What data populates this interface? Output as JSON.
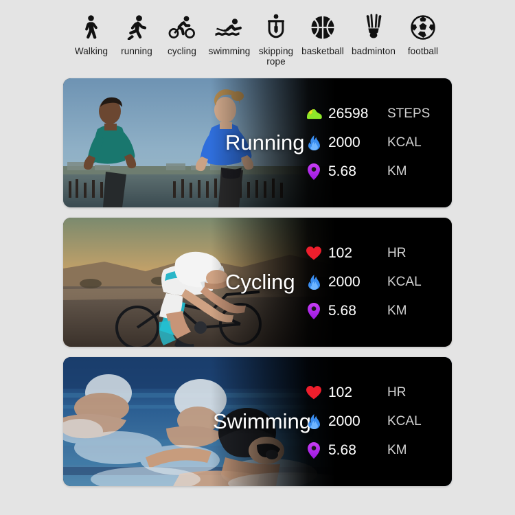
{
  "sports_bar": {
    "items": [
      {
        "icon": "walking-icon",
        "label": "Walking"
      },
      {
        "icon": "running-icon",
        "label": "running"
      },
      {
        "icon": "cycling-icon",
        "label": "cycling"
      },
      {
        "icon": "swimming-icon",
        "label": "swimming"
      },
      {
        "icon": "skipping-rope-icon",
        "label": "skipping rope"
      },
      {
        "icon": "basketball-icon",
        "label": "basketball"
      },
      {
        "icon": "badminton-icon",
        "label": "badminton"
      },
      {
        "icon": "football-icon",
        "label": "football"
      }
    ]
  },
  "cards": [
    {
      "title": "Running",
      "photo": "runners-photo",
      "stats": [
        {
          "icon": "sneaker-icon",
          "icon_color": "#8ee82a",
          "value": "26598",
          "unit": "STEPS"
        },
        {
          "icon": "flame-icon",
          "icon_color": "#3b8ef0",
          "value": "2000",
          "unit": "KCAL"
        },
        {
          "icon": "pin-icon",
          "icon_color": "#b72ef0",
          "value": "5.68",
          "unit": "KM"
        }
      ]
    },
    {
      "title": "Cycling",
      "photo": "cyclist-photo",
      "stats": [
        {
          "icon": "heart-icon",
          "icon_color": "#ee1e2c",
          "value": "102",
          "unit": "HR"
        },
        {
          "icon": "flame-icon",
          "icon_color": "#3b8ef0",
          "value": "2000",
          "unit": "KCAL"
        },
        {
          "icon": "pin-icon",
          "icon_color": "#b72ef0",
          "value": "5.68",
          "unit": "KM"
        }
      ]
    },
    {
      "title": "Swimming",
      "photo": "swimmers-photo",
      "stats": [
        {
          "icon": "heart-icon",
          "icon_color": "#ee1e2c",
          "value": "102",
          "unit": "HR"
        },
        {
          "icon": "flame-icon",
          "icon_color": "#3b8ef0",
          "value": "2000",
          "unit": "KCAL"
        },
        {
          "icon": "pin-icon",
          "icon_color": "#b72ef0",
          "value": "5.68",
          "unit": "KM"
        }
      ]
    }
  ],
  "colors": {
    "page_background": "#e4e4e4",
    "card_background": "#000000",
    "title_text": "#ffffff",
    "unit_text": "#d2d2d2",
    "icon_dark": "#111111"
  }
}
